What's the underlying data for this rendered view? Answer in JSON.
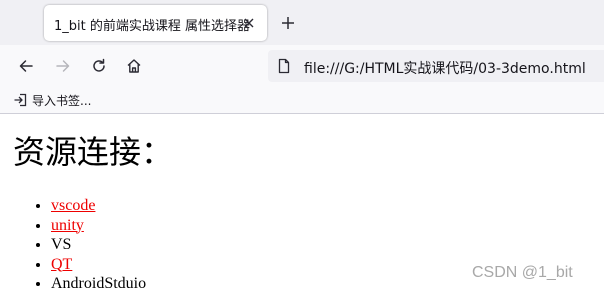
{
  "tab": {
    "title": "1_bit 的前端实战课程 属性选择器"
  },
  "nav": {
    "url": "file:///G:/HTML实战课代码/03-3demo.html"
  },
  "bookmarks": {
    "import_label": "导入书签..."
  },
  "page": {
    "heading": "资源连接：",
    "items": [
      {
        "text": "vscode",
        "link": true
      },
      {
        "text": "unity",
        "link": true
      },
      {
        "text": "VS",
        "link": false
      },
      {
        "text": "QT",
        "link": true
      },
      {
        "text": "AndroidStduio",
        "link": false
      }
    ]
  },
  "watermark": "CSDN @1_bit",
  "colors": {
    "link": "#ee0000",
    "tabstrip": "#f0f0f4",
    "toolbar": "#f9f9fb"
  },
  "icons": [
    "close-icon",
    "plus-icon",
    "back-arrow-icon",
    "forward-arrow-icon",
    "reload-icon",
    "home-icon",
    "file-icon",
    "import-bookmark-icon"
  ]
}
